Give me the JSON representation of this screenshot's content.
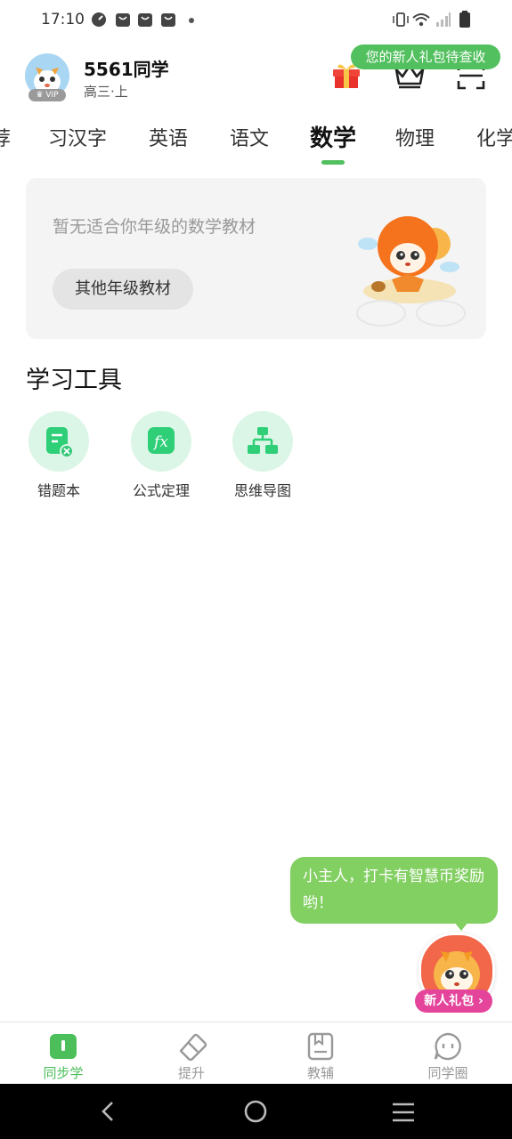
{
  "status_bar": {
    "time": "17:10"
  },
  "header": {
    "user_name": "5561同学",
    "grade": "高三·上",
    "vip_label": "VIP",
    "gift_tooltip": "您的新人礼包待查收"
  },
  "subject_tabs": {
    "items": [
      "荐",
      "习汉字",
      "英语",
      "语文",
      "数学",
      "物理",
      "化学"
    ],
    "active": "数学"
  },
  "textbook_card": {
    "message": "暂无适合你年级的数学教材",
    "button_label": "其他年级教材"
  },
  "tools": {
    "title": "学习工具",
    "items": [
      {
        "label": "错题本",
        "icon": "mistake-book-icon"
      },
      {
        "label": "公式定理",
        "icon": "formula-icon"
      },
      {
        "label": "思维导图",
        "icon": "mind-map-icon"
      }
    ]
  },
  "checkin_bubble": {
    "text": "小主人，打卡有智慧币奖励哟！"
  },
  "newbie_gift": {
    "label": "新人礼包"
  },
  "bottom_nav": {
    "items": [
      {
        "label": "同步学",
        "icon": "book-icon",
        "active": true
      },
      {
        "label": "提升",
        "icon": "eraser-icon",
        "active": false
      },
      {
        "label": "教辅",
        "icon": "workbook-icon",
        "active": false
      },
      {
        "label": "同学圈",
        "icon": "chat-face-icon",
        "active": false
      }
    ]
  },
  "colors": {
    "accent": "#53c05f",
    "bubble": "#82cf62",
    "gift_pink": "#e4459b"
  }
}
